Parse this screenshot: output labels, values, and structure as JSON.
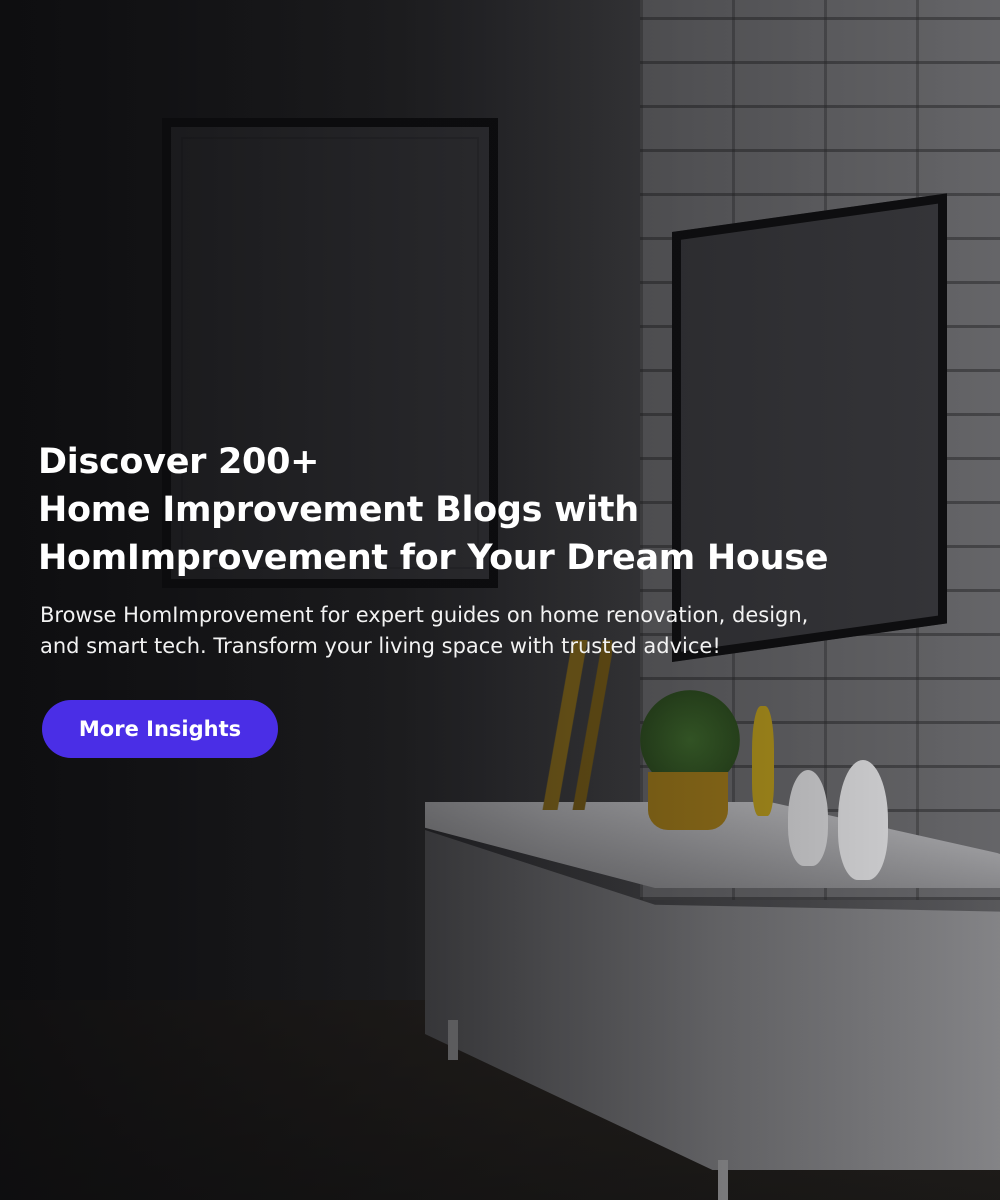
{
  "hero": {
    "headline_lines": [
      "Discover 200+",
      "Home Improvement Blogs with",
      "HomImprovement for Your Dream House"
    ],
    "subtitle_lines": [
      "Browse HomImprovement for expert guides on home renovation, design,",
      "and smart tech. Transform your living space with trusted advice!"
    ],
    "cta_label": "More Insights",
    "accent_color": "#4a2ee6"
  }
}
